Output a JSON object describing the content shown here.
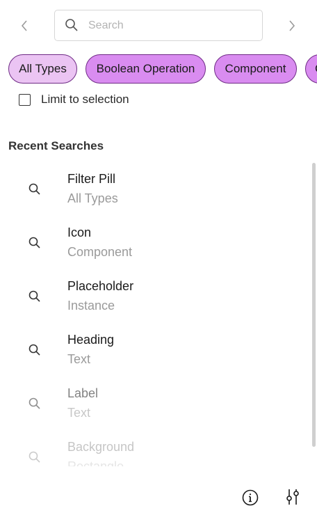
{
  "search": {
    "placeholder": "Search",
    "value": ""
  },
  "nav": {
    "prev_icon": "chevron-left-icon",
    "next_icon": "chevron-right-icon"
  },
  "filters": {
    "pills": [
      {
        "label": "All Types",
        "active": true
      },
      {
        "label": "Boolean Operation",
        "active": false
      },
      {
        "label": "Component",
        "active": false
      },
      {
        "label": "C",
        "active": false
      }
    ]
  },
  "limit": {
    "label": "Limit to selection",
    "checked": false
  },
  "recent": {
    "title": "Recent Searches",
    "items": [
      {
        "title": "Filter Pill",
        "subtitle": "All Types",
        "icon": "search-icon"
      },
      {
        "title": "Icon",
        "subtitle": "Component",
        "icon": "search-icon"
      },
      {
        "title": "Placeholder",
        "subtitle": "Instance",
        "icon": "search-icon"
      },
      {
        "title": "Heading",
        "subtitle": "Text",
        "icon": "search-icon"
      },
      {
        "title": "Label",
        "subtitle": "Text",
        "icon": "search-icon"
      },
      {
        "title": "Background",
        "subtitle": "Rectangle",
        "icon": "search-icon"
      }
    ]
  },
  "footer": {
    "info_icon": "info-icon",
    "settings_icon": "sliders-icon"
  },
  "colors": {
    "pill_active": "#ebc4f3",
    "pill": "#d98cf0",
    "pill_border": "#6e2a85"
  }
}
